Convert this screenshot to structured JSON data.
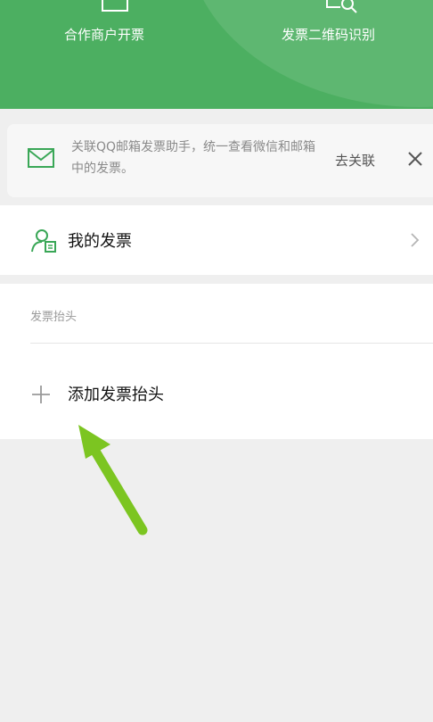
{
  "header": {
    "merchant_label": "合作商户开票",
    "scan_label": "发票二维码识别"
  },
  "banner": {
    "text": "关联QQ邮箱发票助手，统一查看微信和邮箱中的发票。",
    "link_label": "去关联"
  },
  "my_invoice": {
    "label": "我的发票"
  },
  "title_section": {
    "title": "发票抬头",
    "add_label": "添加发票抬头"
  },
  "colors": {
    "header_green": "#4caf61",
    "icon_green": "#3aa757",
    "arrow_green": "#7cc521"
  }
}
